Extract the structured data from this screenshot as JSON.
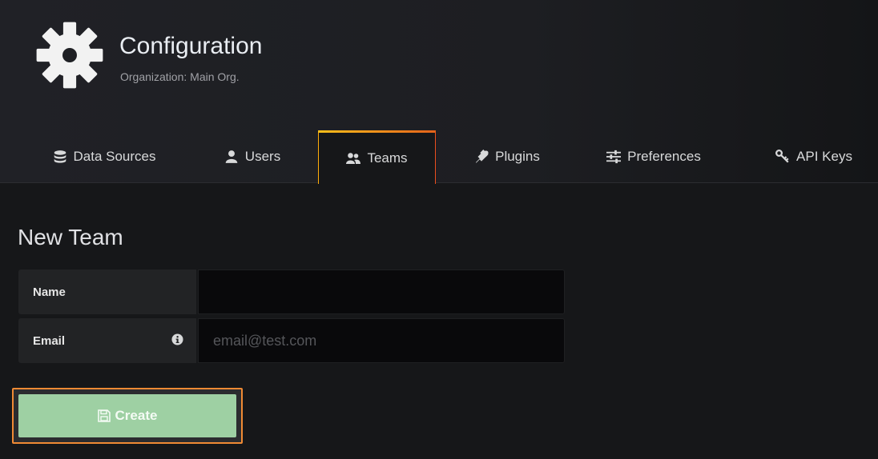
{
  "header": {
    "icon": "gear-icon",
    "title": "Configuration",
    "subtitle": "Organization: Main Org."
  },
  "tabs": [
    {
      "label": "Data Sources",
      "icon": "database-icon",
      "active": false
    },
    {
      "label": "Users",
      "icon": "user-icon",
      "active": false
    },
    {
      "label": "Teams",
      "icon": "users-icon",
      "active": true
    },
    {
      "label": "Plugins",
      "icon": "plug-icon",
      "active": false
    },
    {
      "label": "Preferences",
      "icon": "sliders-icon",
      "active": false
    },
    {
      "label": "API Keys",
      "icon": "key-icon",
      "active": false
    }
  ],
  "form": {
    "heading": "New Team",
    "name_label": "Name",
    "name_value": "",
    "email_label": "Email",
    "email_placeholder": "email@test.com",
    "email_info_icon": "info-icon"
  },
  "actions": {
    "create_label": "Create",
    "create_icon": "save-icon"
  },
  "colors": {
    "accent_gradient_start": "#fbbf1a",
    "accent_gradient_end": "#e3621a",
    "create_button": "#9ed0a3",
    "focus_outline": "#f08a34"
  }
}
